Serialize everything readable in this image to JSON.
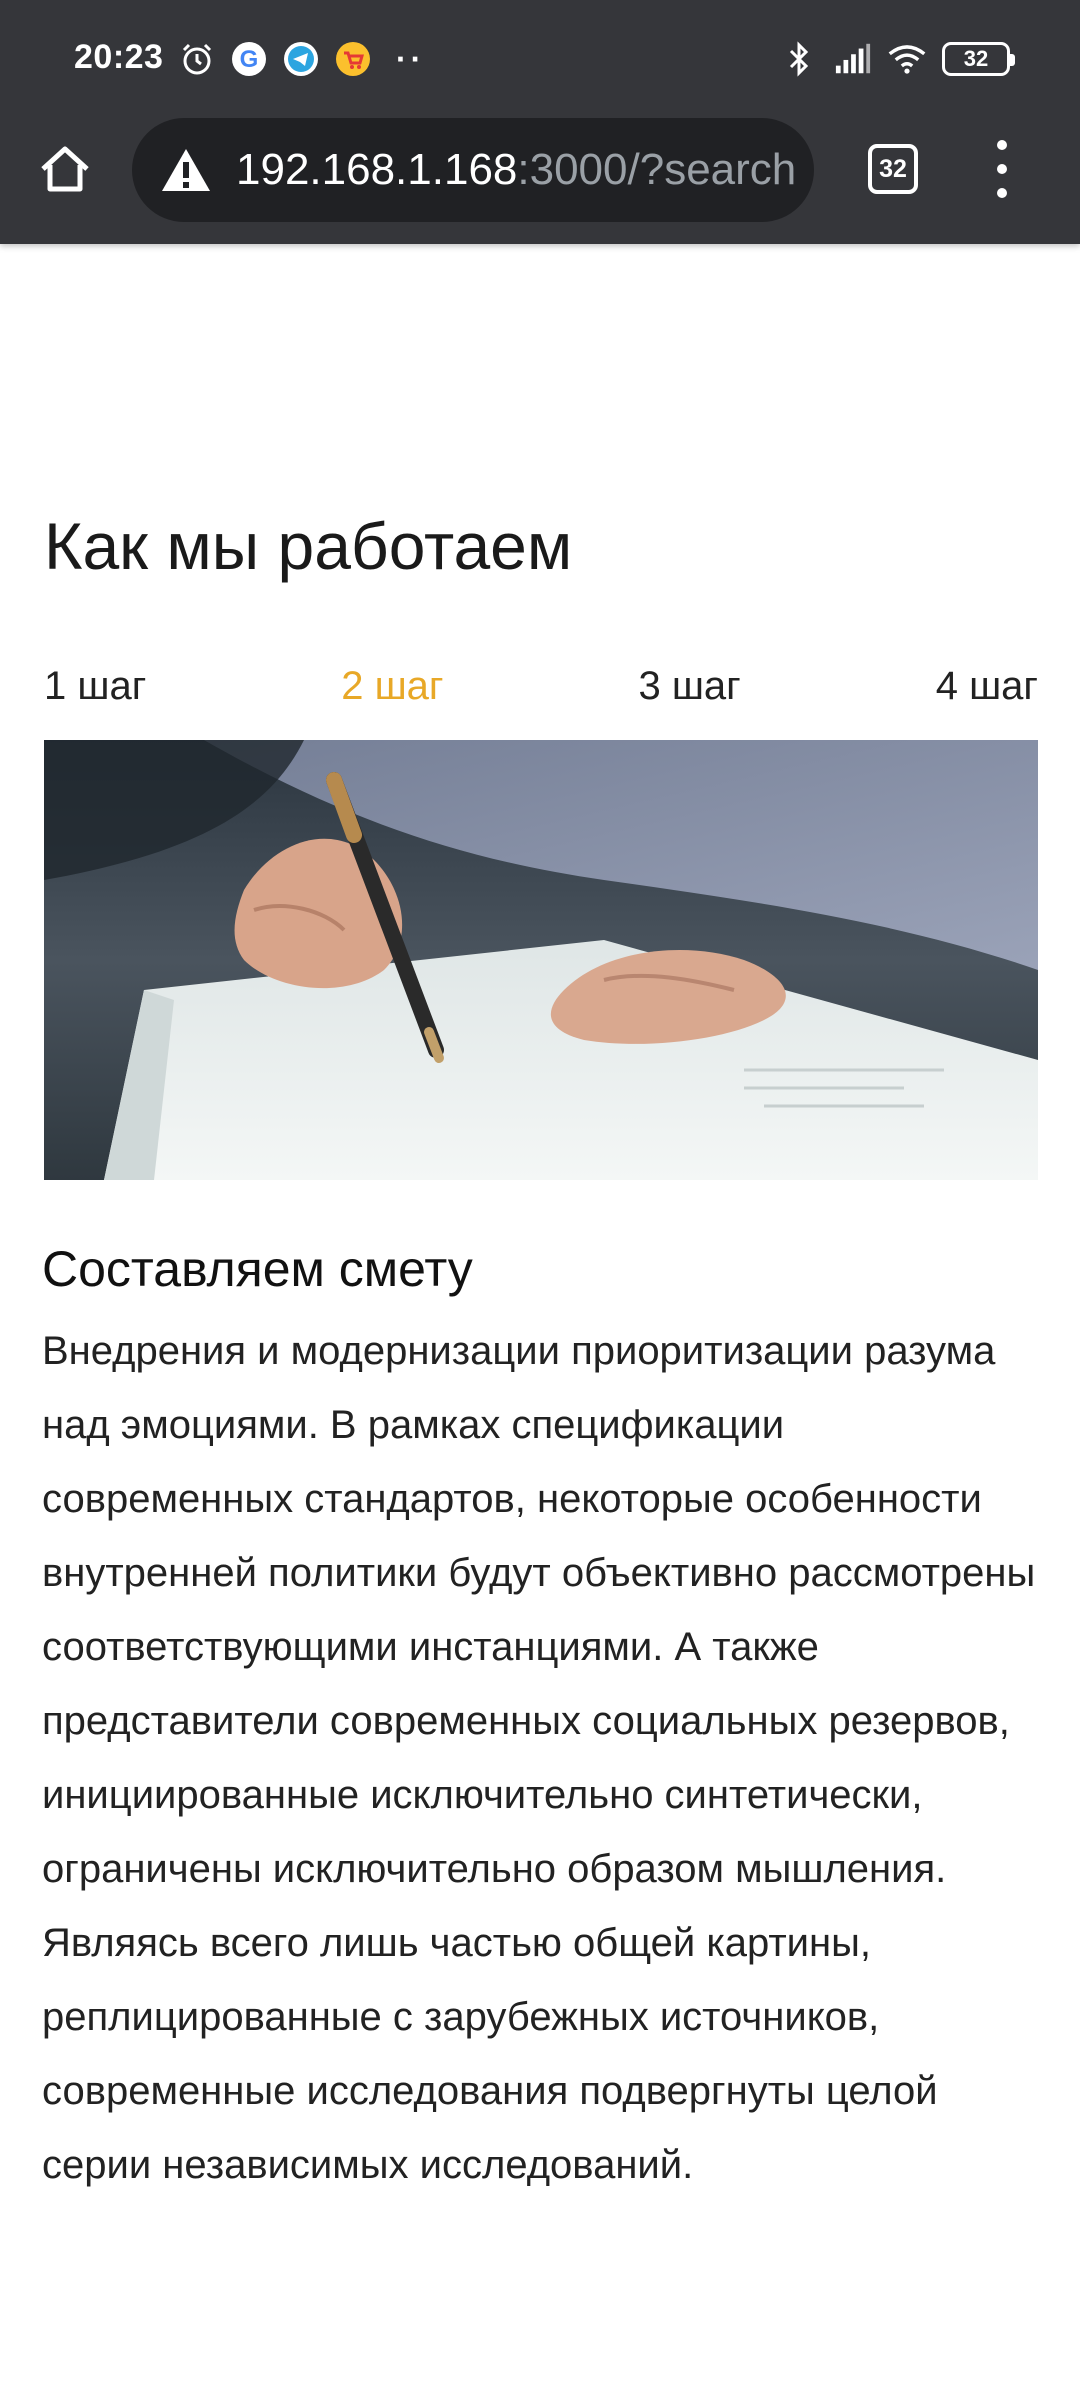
{
  "status_bar": {
    "time": "20:23",
    "left_icons": [
      "alarm-icon",
      "google-icon",
      "telegram-icon",
      "shop-icon"
    ],
    "overflow_dots": "··",
    "right_icons": [
      "bluetooth-icon",
      "signal-icon",
      "wifi-icon"
    ],
    "battery": "32"
  },
  "browser": {
    "url_host": "192.168.1.168",
    "url_rest": ":3000/?search",
    "tab_count": "32"
  },
  "page": {
    "title": "Как мы работаем",
    "steps": [
      {
        "label": "1 шаг",
        "active": false
      },
      {
        "label": "2 шаг",
        "active": true
      },
      {
        "label": "3 шаг",
        "active": false
      },
      {
        "label": "4 шаг",
        "active": false
      }
    ],
    "accent_color": "#e8a827",
    "section": {
      "heading": "Составляем смету",
      "body": "Внедрения и модернизации приоритизации разума над эмоциями. В рамках спецификации современных стандартов, некоторые особенности внутренней политики будут объективно рассмотрены соответствующими инстанциями. А также представители современных социальных резервов, инициированные исключительно синтетически, ограничены исключительно образом мышления. Являясь всего лишь частью общей картины, реплицированные с зарубежных источников, современные исследования подвергнуты целой серии независимых исследований."
    }
  }
}
